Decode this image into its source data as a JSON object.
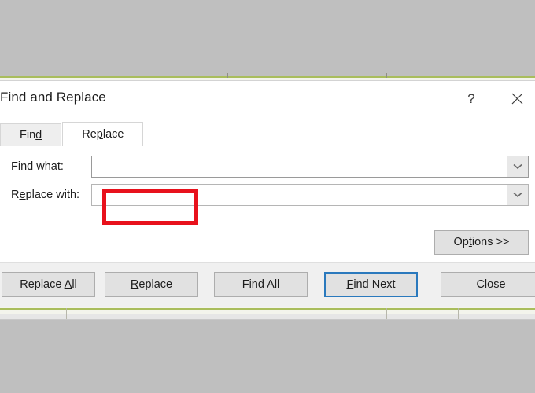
{
  "dialog": {
    "title": "Find and Replace",
    "help_icon": "question-mark-icon",
    "help_label": "?",
    "close_icon": "close-icon",
    "close_label": "✕"
  },
  "tabs": [
    {
      "label": "Find",
      "accel": "d",
      "active": false
    },
    {
      "label": "Replace",
      "accel": "p",
      "active": true
    }
  ],
  "fields": [
    {
      "label": "Find what:",
      "accel": "n",
      "value": "",
      "placeholder": "",
      "focused": true,
      "dropdown_icon": "chevron-down-icon"
    },
    {
      "label": "Replace with:",
      "accel": "e",
      "value": "",
      "placeholder": "",
      "focused": false,
      "dropdown_icon": "chevron-down-icon"
    }
  ],
  "options_button": {
    "label": "Options >>",
    "accel": "t"
  },
  "footer_buttons": [
    {
      "label": "Replace All",
      "accel": "A",
      "default": false,
      "highlighted": false
    },
    {
      "label": "Replace",
      "accel": "R",
      "default": false,
      "highlighted": true
    },
    {
      "label": "Find All",
      "accel": "",
      "default": false,
      "highlighted": false
    },
    {
      "label": "Find Next",
      "accel": "F",
      "default": true,
      "highlighted": false
    },
    {
      "label": "Close",
      "accel": "",
      "default": false,
      "highlighted": false
    }
  ],
  "annotation": {
    "type": "red-highlight-box",
    "target": "Replace",
    "color": "#e8111c"
  },
  "colors": {
    "dialog_bg": "#ffffff",
    "footer_bg": "#f0f0f0",
    "button_bg": "#e1e1e1",
    "button_border": "#adadad",
    "default_focus": "#2a79bd",
    "annotation_red": "#e8111c",
    "desktop_bg": "#bfbfbf",
    "sheet_gridline": "#a9bd5c"
  }
}
